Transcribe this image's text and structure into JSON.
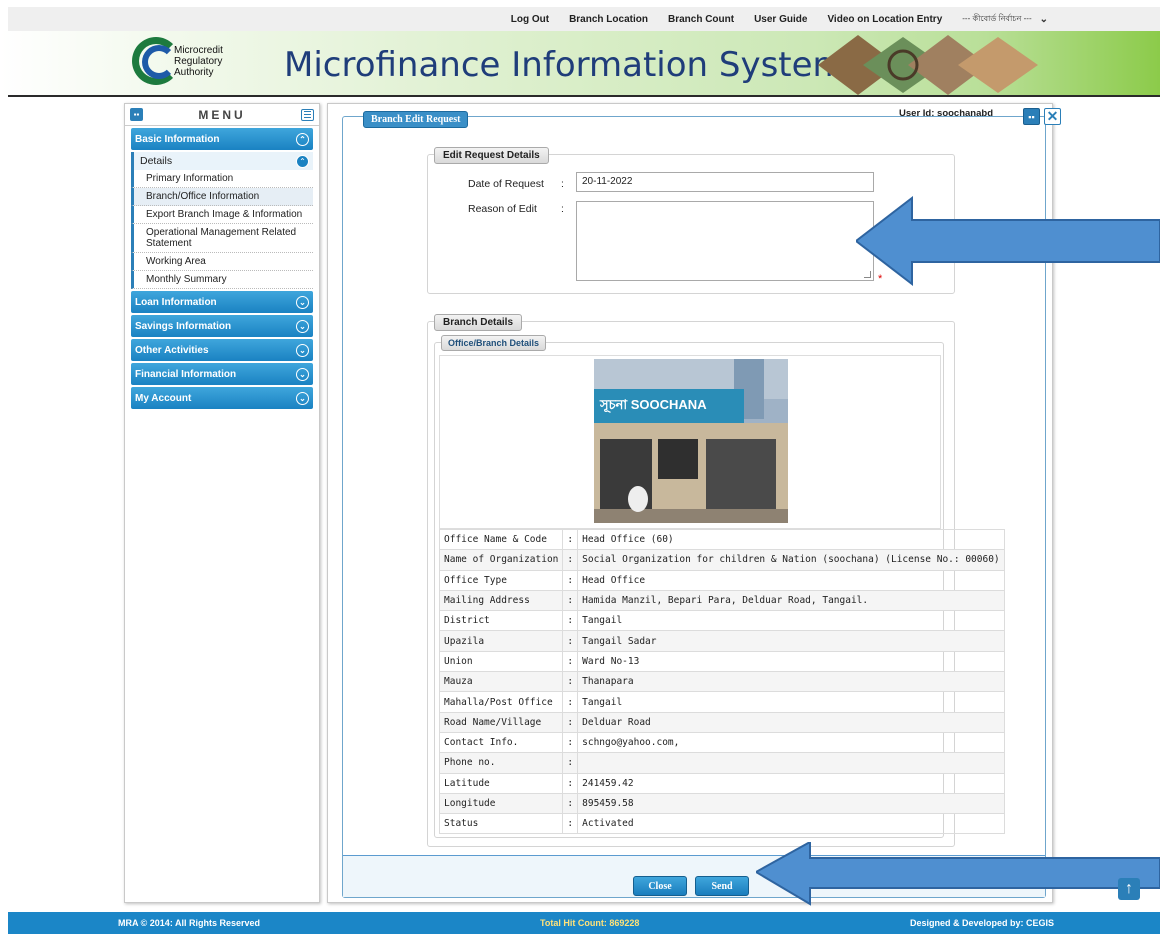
{
  "topnav": {
    "links": [
      "Log Out",
      "Branch Location",
      "Branch Count",
      "User Guide",
      "Video on Location Entry"
    ],
    "language_select": "--- কীবোর্ড নির্বাচন ---"
  },
  "header": {
    "logo_text": [
      "Microcredit",
      "Regulatory",
      "Authority"
    ],
    "title": "Microfinance Information System"
  },
  "sidebar": {
    "title": "MENU",
    "sections": [
      {
        "label": "Basic Information",
        "expanded": true
      },
      {
        "label": "Loan Information"
      },
      {
        "label": "Savings Information"
      },
      {
        "label": "Other Activities"
      },
      {
        "label": "Financial Information"
      },
      {
        "label": "My Account"
      }
    ],
    "details_label": "Details",
    "items": [
      "Primary Information",
      "Branch/Office Information",
      "Export Branch Image & Information",
      "Operational Management Related Statement",
      "Working Area",
      "Monthly Summary"
    ]
  },
  "panel": {
    "title": "Branch Edit Request",
    "user_id": "User Id: soochanabd"
  },
  "edit_request": {
    "legend": "Edit Request Details",
    "date_label": "Date of Request",
    "date_value": "20-11-2022",
    "reason_label": "Reason of Edit",
    "reason_value": "",
    "colon": ":",
    "required_mark": "*"
  },
  "branch_details": {
    "legend": "Branch Details",
    "sub_legend": "Office/Branch Details",
    "rows": [
      {
        "label": "Office Name & Code",
        "value": "Head Office (60)"
      },
      {
        "label": "Name of Organization",
        "value": "Social Organization for children & Nation (soochana) (License No.: 00060)"
      },
      {
        "label": "Office Type",
        "value": "Head Office"
      },
      {
        "label": "Mailing Address",
        "value": "Hamida Manzil, Bepari Para, Delduar Road, Tangail."
      },
      {
        "label": "District",
        "value": "Tangail"
      },
      {
        "label": "Upazila",
        "value": "Tangail Sadar"
      },
      {
        "label": "Union",
        "value": "Ward No-13"
      },
      {
        "label": "Mauza",
        "value": "Thanapara"
      },
      {
        "label": "Mahalla/Post Office",
        "value": "Tangail"
      },
      {
        "label": "Road Name/Village",
        "value": "Delduar Road"
      },
      {
        "label": "Contact Info.",
        "value": "schngo@yahoo.com,"
      },
      {
        "label": "Phone no.",
        "value": ""
      },
      {
        "label": "Latitude",
        "value": "241459.42"
      },
      {
        "label": "Longitude",
        "value": "895459.58"
      },
      {
        "label": "Status",
        "value": "Activated"
      }
    ],
    "photo_sign_text": "সূচনা SOOCHANA"
  },
  "buttons": {
    "close": "Close",
    "send": "Send"
  },
  "footer": {
    "copyright": "MRA © 2014: All Rights Reserved",
    "hit_count": "Total Hit Count: 869228",
    "developer": "Designed & Developed by: CEGIS"
  },
  "colors": {
    "accent": "#1b86c7",
    "annotation_arrow": "#4f8fd0"
  }
}
